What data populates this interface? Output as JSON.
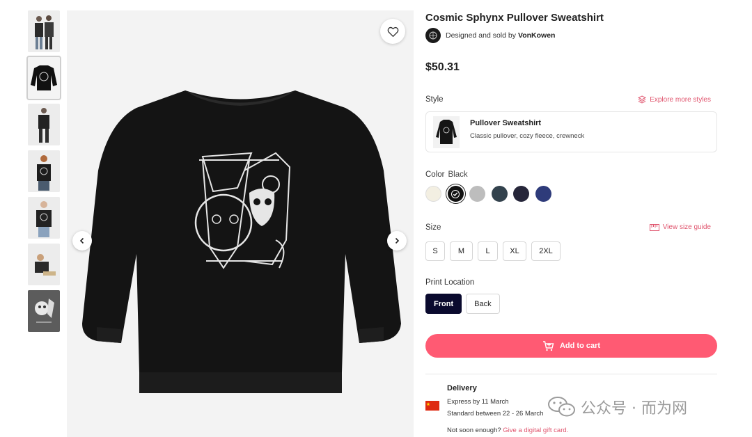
{
  "product": {
    "title": "Cosmic Sphynx Pullover Sweatshirt",
    "designer_prefix": "Designed and sold by",
    "designer_name": "VonKowen",
    "price": "$50.31"
  },
  "thumbnails": [
    {
      "icon": "thumbnail-couple-sweatshirt"
    },
    {
      "icon": "thumbnail-flat-sweatshirt"
    },
    {
      "icon": "thumbnail-model-back"
    },
    {
      "icon": "thumbnail-model-front"
    },
    {
      "icon": "thumbnail-model-hood"
    },
    {
      "icon": "thumbnail-model-sitting"
    },
    {
      "icon": "thumbnail-artwork"
    }
  ],
  "style": {
    "label": "Style",
    "explore_link": "Explore more styles",
    "card_name": "Pullover Sweatshirt",
    "card_desc": "Classic pullover, cozy fleece, crewneck"
  },
  "color": {
    "label": "Color",
    "selected": "Black",
    "swatches": [
      "#f3efe2",
      "#111111",
      "#bdbdbd",
      "#33424d",
      "#26263a",
      "#2e3b7a"
    ]
  },
  "size": {
    "label": "Size",
    "guide_link": "View size guide",
    "options": [
      "S",
      "M",
      "L",
      "XL",
      "2XL"
    ]
  },
  "print_location": {
    "label": "Print Location",
    "options": [
      "Front",
      "Back"
    ],
    "selected": "Front"
  },
  "cart": {
    "label": "Add to cart"
  },
  "delivery": {
    "title": "Delivery",
    "express": "Express by 11 March",
    "standard": "Standard between 22 - 26 March",
    "not_soon": "Not soon enough?",
    "gift_link": "Give a digital gift card."
  },
  "watermark": {
    "text": "公众号 · 而为网"
  },
  "colors": {
    "accent": "#ff5a73",
    "link": "#e0556e",
    "active_location": "#0a0a2e"
  }
}
